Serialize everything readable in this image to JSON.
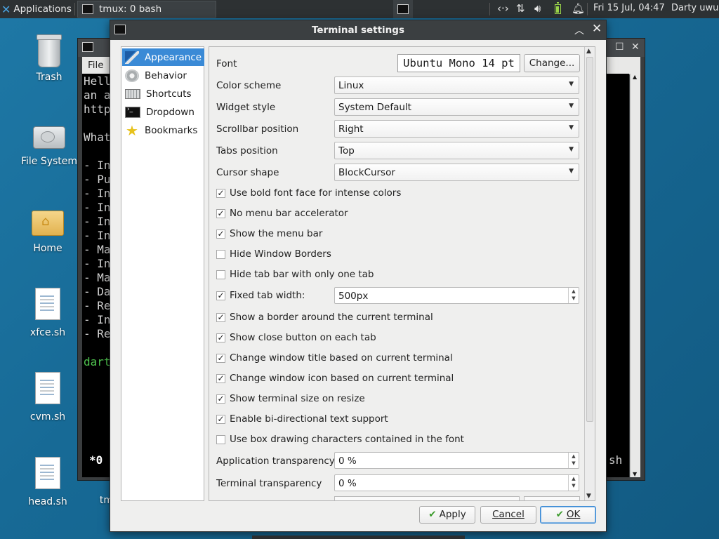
{
  "panel": {
    "apps_label": "Applications",
    "task_label": "tmux: 0 bash",
    "clock": "Fri 15 Jul, 04:47",
    "user": "Darty uwu"
  },
  "desktop": {
    "icons": [
      {
        "label": "Trash",
        "icon": "trash-icon"
      },
      {
        "label": "File System",
        "icon": "disk-icon"
      },
      {
        "label": "Home",
        "icon": "home-folder-icon"
      },
      {
        "label": "xfce.sh",
        "icon": "script-file-icon"
      },
      {
        "label": "cvm.sh",
        "icon": "script-file-icon"
      },
      {
        "label": "head.sh",
        "icon": "script-file-icon"
      },
      {
        "label": "tmux",
        "icon": ""
      }
    ]
  },
  "terminal": {
    "menu_file": "File",
    "lines": [
      "Hell",
      "an a",
      "http",
      "",
      "What",
      "",
      "- In",
      "- Pu",
      "- In",
      "- In",
      "- In",
      "- In",
      "- Ma",
      "- In",
      "- Ma",
      "- Da",
      "- Re",
      "- In",
      "- Re",
      "",
      "dart"
    ],
    "status_left": "*0",
    "status_right": "sh"
  },
  "dialog": {
    "title": "Terminal settings",
    "nav": [
      {
        "label": "Appearance",
        "icon": "brush-icon",
        "selected": true
      },
      {
        "label": "Behavior",
        "icon": "gear-icon",
        "selected": false
      },
      {
        "label": "Shortcuts",
        "icon": "keyboard-icon",
        "selected": false
      },
      {
        "label": "Dropdown",
        "icon": "terminal-icon",
        "selected": false
      },
      {
        "label": "Bookmarks",
        "icon": "star-icon",
        "selected": false
      }
    ],
    "font_label": "Font",
    "font_value": "Ubuntu Mono 14 pt",
    "change_button": "Change...",
    "combos": [
      {
        "label": "Color scheme",
        "value": "Linux"
      },
      {
        "label": "Widget style",
        "value": "System Default"
      },
      {
        "label": "Scrollbar position",
        "value": "Right"
      },
      {
        "label": "Tabs position",
        "value": "Top"
      },
      {
        "label": "Cursor shape",
        "value": "BlockCursor"
      }
    ],
    "checkboxes_a": [
      {
        "label": "Use bold font face for intense colors",
        "checked": true
      },
      {
        "label": "No menu bar accelerator",
        "checked": true
      },
      {
        "label": "Show the menu bar",
        "checked": true
      },
      {
        "label": "Hide Window Borders",
        "checked": false
      },
      {
        "label": "Hide tab bar with only one tab",
        "checked": false
      }
    ],
    "fixed_tab_width": {
      "label": "Fixed tab width:",
      "checked": true,
      "value": "500px"
    },
    "checkboxes_b": [
      {
        "label": "Show a border around the current terminal",
        "checked": true
      },
      {
        "label": "Show close button on each tab",
        "checked": true
      },
      {
        "label": "Change window title based on current terminal",
        "checked": true
      },
      {
        "label": "Change window icon based on current terminal",
        "checked": true
      },
      {
        "label": "Show terminal size on resize",
        "checked": true
      },
      {
        "label": "Enable bi-directional text support",
        "checked": true
      },
      {
        "label": "Use box drawing characters contained in the font",
        "checked": false
      }
    ],
    "app_transparency": {
      "label": "Application transparency",
      "value": "0 %"
    },
    "term_transparency": {
      "label": "Terminal transparency",
      "value": "0 %"
    },
    "buttons": {
      "apply": "Apply",
      "cancel": "Cancel",
      "ok": "OK"
    }
  },
  "colors": {
    "accent": "#3a8ad6",
    "desktop": "#176a96",
    "panel": "#2d3133"
  }
}
